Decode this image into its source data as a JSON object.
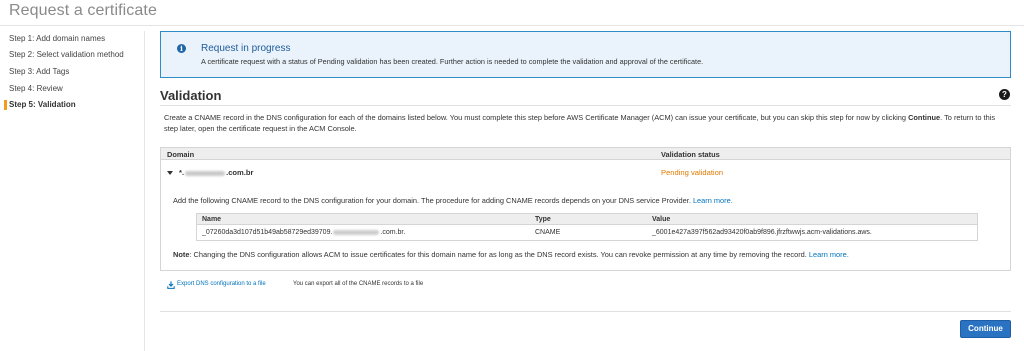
{
  "page": {
    "title": "Request a certificate"
  },
  "steps": [
    {
      "label": "Step 1: Add domain names",
      "active": false
    },
    {
      "label": "Step 2: Select validation method",
      "active": false
    },
    {
      "label": "Step 3: Add Tags",
      "active": false
    },
    {
      "label": "Step 4: Review",
      "active": false
    },
    {
      "label": "Step 5: Validation",
      "active": true
    }
  ],
  "info": {
    "icon": "info-icon",
    "title": "Request in progress",
    "text": "A certificate request with a status of Pending validation has been created. Further action is needed to complete the validation and approval of the certificate."
  },
  "validation": {
    "title": "Validation",
    "help_icon": "help-icon",
    "description_before": "Create a CNAME record in the DNS configuration for each of the domains listed below. You must complete this step before AWS Certificate Manager (ACM) can issue your certificate, but you can skip this step for now by clicking ",
    "description_bold": "Continue",
    "description_after": ". To return to this step later, open the certificate request in the ACM Console."
  },
  "table": {
    "headers": {
      "domain": "Domain",
      "status": "Validation status"
    },
    "row": {
      "domain_prefix": "*.",
      "domain_suffix": ".com.br",
      "status": "Pending validation",
      "status_color": "#e07b00",
      "instructions": "Add the following CNAME record to the DNS configuration for your domain. The procedure for adding CNAME records depends on your DNS service Provider. ",
      "learn_more": "Learn more.",
      "record_headers": {
        "name": "Name",
        "type": "Type",
        "value": "Value"
      },
      "record": {
        "name_prefix": "_07260da3d107d51b49ab58729ed39709.",
        "name_suffix": ".com.br.",
        "type": "CNAME",
        "value": "_6001e427a397f562ad93420f0ab9f896.jfrzftwwjs.acm-validations.aws."
      },
      "note_label": "Note",
      "note_text": ": Changing the DNS configuration allows ACM to issue certificates for this domain name for as long as the DNS record exists. You can revoke permission at any time by removing the record. ",
      "note_link": "Learn more."
    }
  },
  "export": {
    "icon": "download-icon",
    "link": "Export DNS configuration to a file",
    "hint": "You can export all of the CNAME records to a file"
  },
  "footer": {
    "continue_label": "Continue",
    "accent": "#2a73c2"
  }
}
